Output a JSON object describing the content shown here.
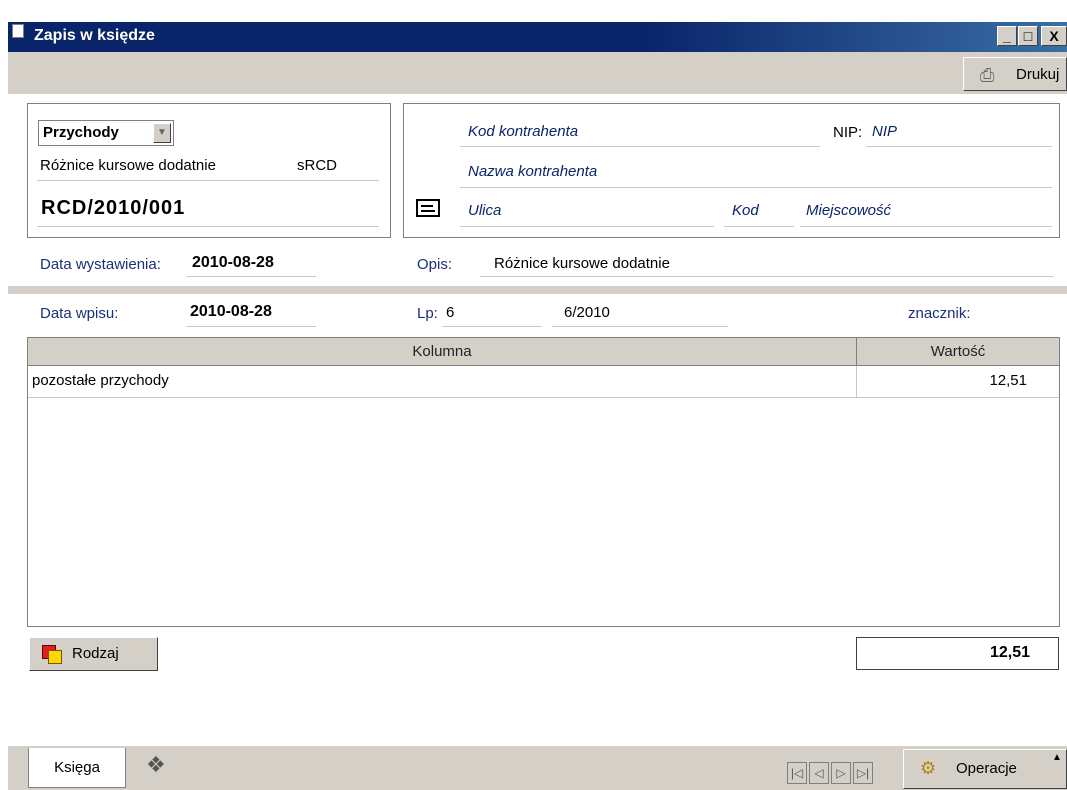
{
  "window": {
    "title": "Zapis w księdze",
    "minimize": "_",
    "maximize": "□",
    "close": "X"
  },
  "toolbar": {
    "print_label": "Drukuj",
    "print_icon": "printer-icon"
  },
  "document": {
    "type": "Przychody",
    "category_name": "Różnice kursowe dodatnie",
    "category_code": "sRCD",
    "number": "RCD/2010/001",
    "issue_date_label": "Data wystawienia:",
    "issue_date": "2010-08-28"
  },
  "contractor": {
    "code_placeholder": "Kod kontrahenta",
    "nip_label": "NIP:",
    "nip_placeholder": "NIP",
    "name_placeholder": "Nazwa kontrahenta",
    "street_placeholder": "Ulica",
    "postcode_placeholder": "Kod",
    "city_placeholder": "Miejscowość"
  },
  "description": {
    "label": "Opis:",
    "value": "Różnice kursowe dodatnie"
  },
  "entry": {
    "date_label": "Data wpisu:",
    "date": "2010-08-28",
    "lp_label": "Lp:",
    "lp_value": "6",
    "lp_number": "6/2010",
    "marker_label": "znacznik:"
  },
  "grid": {
    "columns": [
      "Kolumna",
      "Wartość"
    ],
    "rows": [
      {
        "kolumna": "pozostałe przychody",
        "wartosc": "12,51"
      }
    ],
    "total": "12,51"
  },
  "kind_button": {
    "label": "Rodzaj"
  },
  "bottom": {
    "tabs": [
      "Księga"
    ],
    "nav": [
      "|◁",
      "◁",
      "▷",
      "▷|"
    ],
    "operations_label": "Operacje"
  }
}
